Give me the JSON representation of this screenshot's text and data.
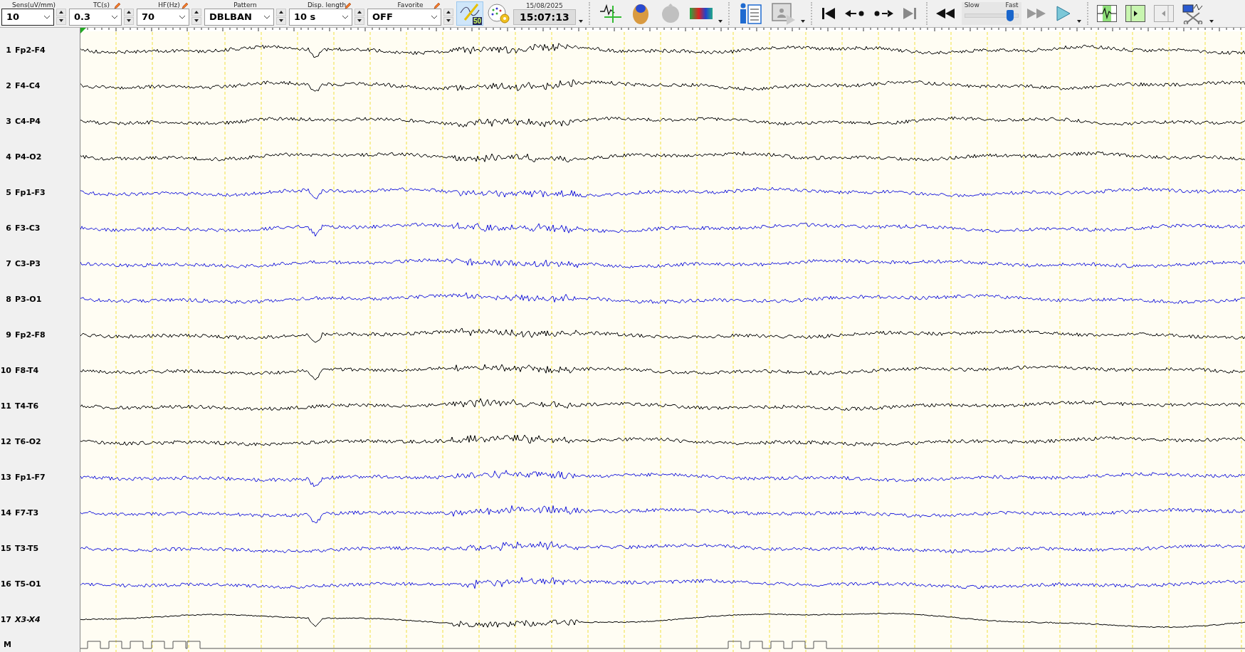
{
  "toolbar": {
    "controls": [
      {
        "label": "Sens(uV/mm)",
        "value": "10",
        "edit_icon": false
      },
      {
        "label": "TC(s)",
        "value": "0.3",
        "edit_icon": true
      },
      {
        "label": "HF(Hz)",
        "value": "70",
        "edit_icon": true
      },
      {
        "label": "Pattern",
        "value": "DBLBAN",
        "edit_icon": false
      },
      {
        "label": "Disp. length",
        "value": "10 s",
        "edit_icon": true
      },
      {
        "label": "Favorite",
        "value": "OFF",
        "edit_icon": true
      }
    ],
    "filter_badge": "50",
    "date": "15/08/2025",
    "time": "15:07:13",
    "speed": {
      "slow_label": "Slow",
      "fast_label": "Fast",
      "level": 0.85
    }
  },
  "channels": [
    {
      "number": "1",
      "name": "Fp2-F4",
      "color": "#000000",
      "kind": "eeg"
    },
    {
      "number": "2",
      "name": "F4-C4",
      "color": "#000000",
      "kind": "eeg"
    },
    {
      "number": "3",
      "name": "C4-P4",
      "color": "#000000",
      "kind": "eeg"
    },
    {
      "number": "4",
      "name": "P4-O2",
      "color": "#000000",
      "kind": "eeg"
    },
    {
      "number": "5",
      "name": "Fp1-F3",
      "color": "#1a1adc",
      "kind": "eeg"
    },
    {
      "number": "6",
      "name": "F3-C3",
      "color": "#1a1adc",
      "kind": "eeg"
    },
    {
      "number": "7",
      "name": "C3-P3",
      "color": "#1a1adc",
      "kind": "eeg"
    },
    {
      "number": "8",
      "name": "P3-O1",
      "color": "#1a1adc",
      "kind": "eeg"
    },
    {
      "number": "9",
      "name": "Fp2-F8",
      "color": "#000000",
      "kind": "eeg"
    },
    {
      "number": "10",
      "name": "F8-T4",
      "color": "#000000",
      "kind": "eeg"
    },
    {
      "number": "11",
      "name": "T4-T6",
      "color": "#000000",
      "kind": "eeg"
    },
    {
      "number": "12",
      "name": "T6-O2",
      "color": "#000000",
      "kind": "eeg"
    },
    {
      "number": "13",
      "name": "Fp1-F7",
      "color": "#1a1adc",
      "kind": "eeg"
    },
    {
      "number": "14",
      "name": "F7-T3",
      "color": "#1a1adc",
      "kind": "eeg"
    },
    {
      "number": "15",
      "name": "T3-T5",
      "color": "#1a1adc",
      "kind": "eeg"
    },
    {
      "number": "16",
      "name": "T5-O1",
      "color": "#1a1adc",
      "kind": "eeg"
    },
    {
      "number": "17",
      "name": "X3-X4",
      "color": "#000000",
      "kind": "aux"
    }
  ],
  "marker_row": {
    "label": "M"
  }
}
